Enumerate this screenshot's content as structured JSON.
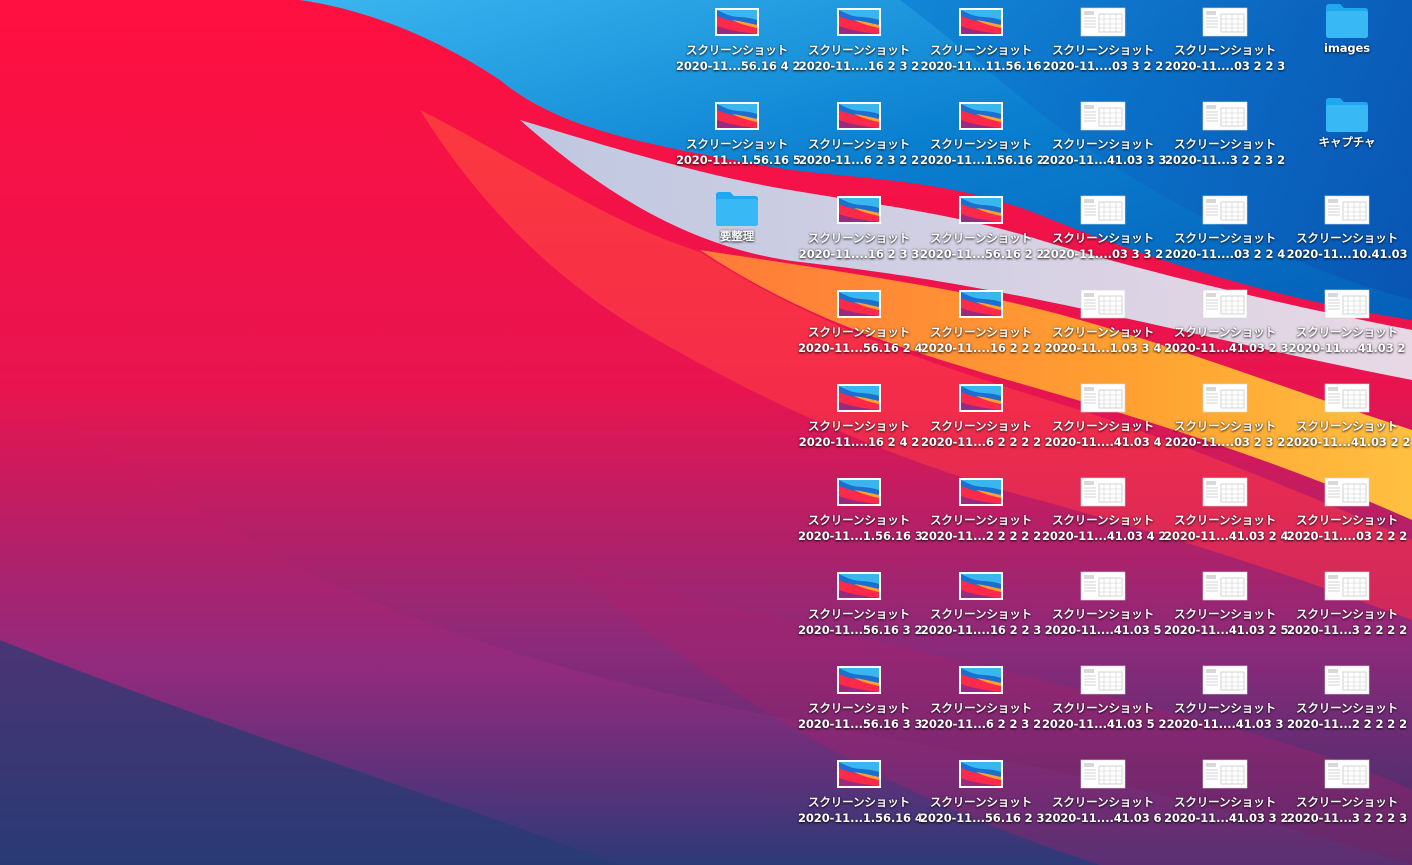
{
  "desktop": {
    "columns": [
      {
        "items": [
          {
            "type": "image",
            "line1": "スクリーンショット",
            "line2": "2020-11...56.16 4 2"
          },
          {
            "type": "image",
            "line1": "スクリーンショット",
            "line2": "2020-11...1.56.16 5"
          },
          {
            "type": "folder",
            "line1": "要整理",
            "line2": ""
          }
        ]
      },
      {
        "items": [
          {
            "type": "image",
            "line1": "スクリーンショット",
            "line2": "2020-11....16 2 3 2"
          },
          {
            "type": "image",
            "line1": "スクリーンショット",
            "line2": "2020-11...6 2 3 2 2"
          },
          {
            "type": "image",
            "line1": "スクリーンショット",
            "line2": "2020-11....16 2 3 3"
          },
          {
            "type": "image",
            "line1": "スクリーンショット",
            "line2": "2020-11...56.16 2 4"
          },
          {
            "type": "image",
            "line1": "スクリーンショット",
            "line2": "2020-11....16 2 4 2"
          },
          {
            "type": "image",
            "line1": "スクリーンショット",
            "line2": "2020-11...1.56.16 3"
          },
          {
            "type": "image",
            "line1": "スクリーンショット",
            "line2": "2020-11...56.16 3 2"
          },
          {
            "type": "image",
            "line1": "スクリーンショット",
            "line2": "2020-11...56.16 3 3"
          },
          {
            "type": "image",
            "line1": "スクリーンショット",
            "line2": "2020-11...1.56.16 4"
          }
        ]
      },
      {
        "items": [
          {
            "type": "image",
            "line1": "スクリーンショット",
            "line2": "2020-11...11.56.16"
          },
          {
            "type": "image",
            "line1": "スクリーンショット",
            "line2": "2020-11...1.56.16 2"
          },
          {
            "type": "image",
            "line1": "スクリーンショット",
            "line2": "2020-11...56.16 2 2"
          },
          {
            "type": "image",
            "line1": "スクリーンショット",
            "line2": "2020-11....16 2 2 2"
          },
          {
            "type": "image",
            "line1": "スクリーンショット",
            "line2": "2020-11...6 2 2 2 2"
          },
          {
            "type": "image",
            "line1": "スクリーンショット",
            "line2": "2020-11...2 2 2 2 2"
          },
          {
            "type": "image",
            "line1": "スクリーンショット",
            "line2": "2020-11....16 2 2 3"
          },
          {
            "type": "image",
            "line1": "スクリーンショット",
            "line2": "2020-11...6 2 2 3 2"
          },
          {
            "type": "image",
            "line1": "スクリーンショット",
            "line2": "2020-11...56.16 2 3"
          }
        ]
      },
      {
        "items": [
          {
            "type": "doc",
            "line1": "スクリーンショット",
            "line2": "2020-11....03 3 2 2"
          },
          {
            "type": "doc",
            "line1": "スクリーンショット",
            "line2": "2020-11...41.03 3 3"
          },
          {
            "type": "doc",
            "line1": "スクリーンショット",
            "line2": "2020-11....03 3 3 2"
          },
          {
            "type": "doc",
            "line1": "スクリーンショット",
            "line2": "2020-11...1.03 3 4"
          },
          {
            "type": "doc",
            "line1": "スクリーンショット",
            "line2": "2020-11....41.03 4"
          },
          {
            "type": "doc",
            "line1": "スクリーンショット",
            "line2": "2020-11...41.03 4 2"
          },
          {
            "type": "doc",
            "line1": "スクリーンショット",
            "line2": "2020-11....41.03 5"
          },
          {
            "type": "doc",
            "line1": "スクリーンショット",
            "line2": "2020-11...41.03 5 2"
          },
          {
            "type": "doc",
            "line1": "スクリーンショット",
            "line2": "2020-11....41.03 6"
          }
        ]
      },
      {
        "items": [
          {
            "type": "doc",
            "line1": "スクリーンショット",
            "line2": "2020-11....03 2 2 3"
          },
          {
            "type": "doc",
            "line1": "スクリーンショット",
            "line2": "2020-11...3 2 2 3 2"
          },
          {
            "type": "doc",
            "line1": "スクリーンショット",
            "line2": "2020-11....03 2 2 4"
          },
          {
            "type": "doc",
            "line1": "スクリーンショット",
            "line2": "2020-11...41.03 2 3"
          },
          {
            "type": "doc",
            "line1": "スクリーンショット",
            "line2": "2020-11....03 2 3 2"
          },
          {
            "type": "doc",
            "line1": "スクリーンショット",
            "line2": "2020-11...41.03 2 4"
          },
          {
            "type": "doc",
            "line1": "スクリーンショット",
            "line2": "2020-11...41.03 2 5"
          },
          {
            "type": "doc",
            "line1": "スクリーンショット",
            "line2": "2020-11....41.03 3"
          },
          {
            "type": "doc",
            "line1": "スクリーンショット",
            "line2": "2020-11...41.03 3 2"
          }
        ]
      },
      {
        "items": [
          {
            "type": "folder",
            "line1": "images",
            "line2": ""
          },
          {
            "type": "folder",
            "line1": "キャプチャ",
            "line2": ""
          },
          {
            "type": "doc",
            "line1": "スクリーンショット",
            "line2": "2020-11...10.41.03"
          },
          {
            "type": "doc",
            "line1": "スクリーンショット",
            "line2": "2020-11....41.03 2"
          },
          {
            "type": "doc",
            "line1": "スクリーンショット",
            "line2": "2020-11...41.03 2 2"
          },
          {
            "type": "doc",
            "line1": "スクリーンショット",
            "line2": "2020-11....03 2 2 2"
          },
          {
            "type": "doc",
            "line1": "スクリーンショット",
            "line2": "2020-11...3 2 2 2 2"
          },
          {
            "type": "doc",
            "line1": "スクリーンショット",
            "line2": "2020-11...2 2 2 2 2"
          },
          {
            "type": "doc",
            "line1": "スクリーンショット",
            "line2": "2020-11...3 2 2 2 3"
          }
        ]
      }
    ]
  },
  "colors": {
    "folder": "#1ea8f0",
    "folder_tab": "#38b8f5",
    "label_text": "#ffffff"
  },
  "icons": {
    "image": "screenshot-thumbnail-icon",
    "doc": "document-screenshot-icon",
    "folder": "folder-icon"
  }
}
